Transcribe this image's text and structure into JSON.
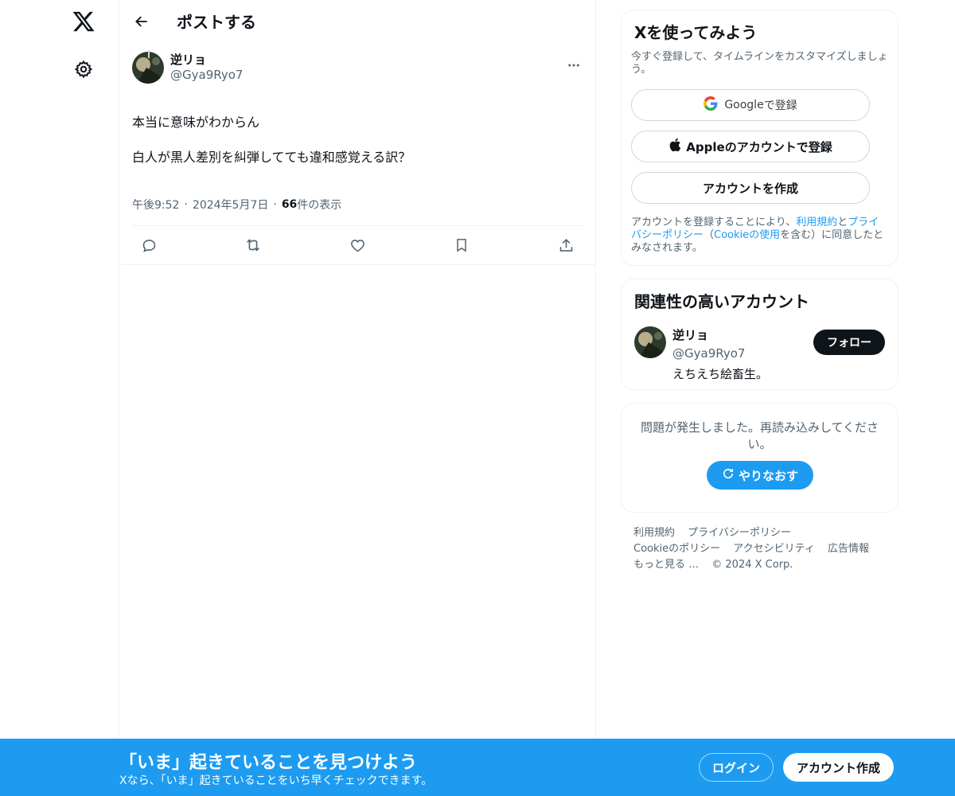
{
  "nav": {
    "logo_icon": "x-logo-icon",
    "settings_icon": "gear-icon"
  },
  "header": {
    "title": "ポストする",
    "back_icon": "arrow-left-icon"
  },
  "post": {
    "author_name": "逆リョ",
    "author_handle": "@Gya9Ryo7",
    "text_line1": "本当に意味がわからん",
    "text_line2": "白人が黒人差別を糾弾してても違和感覚える訳？",
    "time": "午後9:52",
    "date": "2024年5月7日",
    "view_count": "66",
    "view_label": " 件の表示",
    "separator": "·"
  },
  "signup": {
    "title": "Xを使ってみよう",
    "subtitle": "今すぐ登録して、タイムラインをカスタマイズしましょう。",
    "google_label_brand": "Google",
    "google_label_rest": " で登録",
    "apple_label": "Appleのアカウントで登録",
    "create_label": "アカウントを作成",
    "legal_prefix": "アカウントを登録することにより、",
    "legal_terms": "利用規約",
    "legal_and": "と",
    "legal_privacy": "プライバシーポリシー",
    "legal_mid": "（",
    "legal_cookie": "Cookieの使用",
    "legal_suffix": "を含む）に同意したとみなされます。"
  },
  "related": {
    "title": "関連性の高いアカウント",
    "name": "逆リョ",
    "handle": "@Gya9Ryo7",
    "bio": "えちえち絵畜生。",
    "follow_label": "フォロー"
  },
  "error": {
    "message": "問題が発生しました。再読み込みしてください。",
    "retry_label": "やりなおす"
  },
  "footer": {
    "links": [
      "利用規約",
      "プライバシーポリシー",
      "Cookieのポリシー",
      "アクセシビリティ",
      "広告情報",
      "もっと見る …"
    ],
    "copyright": "© 2024 X Corp."
  },
  "banner": {
    "title": "「いま」起きていることを見つけよう",
    "subtitle": "Xなら、「いま」起きていることをいち早くチェックできます。",
    "login_label": "ログイン",
    "create_label": "アカウント作成"
  },
  "colors": {
    "accent": "#1d9bf0",
    "text": "#0f1419",
    "secondary": "#536471",
    "border": "#eff3f4"
  }
}
